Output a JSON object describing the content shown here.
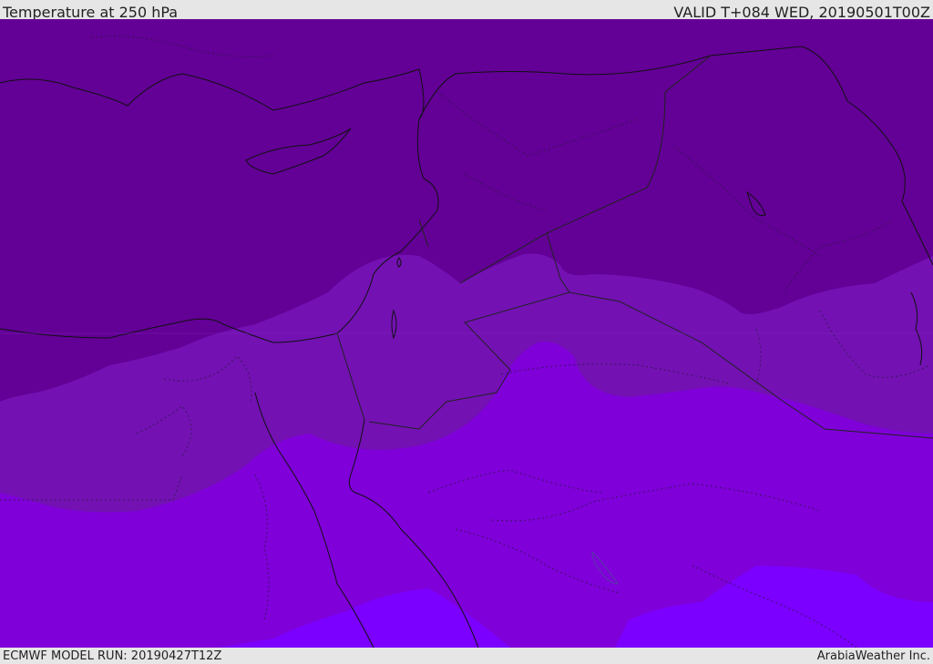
{
  "header": {
    "title": "Temperature at 250 hPa",
    "valid_time": "VALID T+084 WED, 20190501T00Z"
  },
  "footer": {
    "model_run": "ECMWF MODEL RUN: 20190427T12Z",
    "credit": "ArabiaWeather Inc."
  },
  "map": {
    "field": "temperature-250hpa",
    "shading_bands": [
      {
        "name": "coldest-band",
        "color": "#630096"
      },
      {
        "name": "cold-band",
        "color": "#7311b3"
      },
      {
        "name": "mid-band",
        "color": "#7f00d9"
      },
      {
        "name": "warm-band",
        "color": "#7b00ff"
      }
    ],
    "coastline_color": "#111111",
    "border_color": "#222222"
  }
}
